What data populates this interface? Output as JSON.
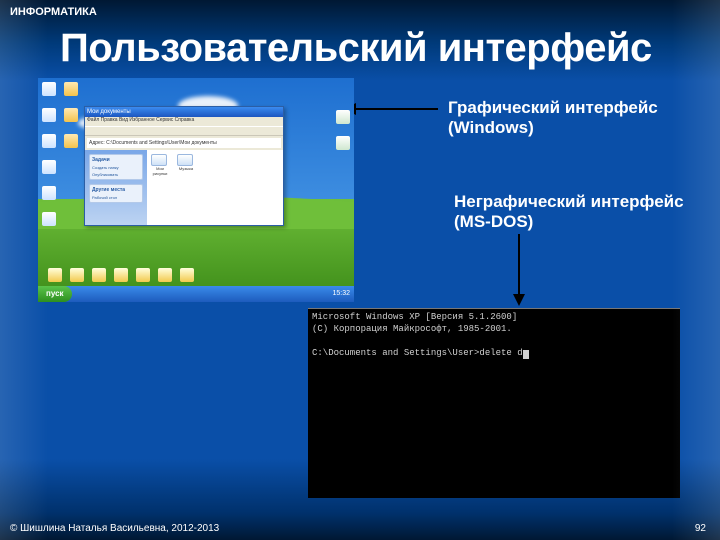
{
  "header": {
    "course": "ИНФОРМАТИКА"
  },
  "title": "Пользовательский интерфейс",
  "labels": {
    "gui_title": "Графический интерфейс",
    "gui_sub": "(Windows)",
    "cli_title": "Неграфический интерфейс",
    "cli_sub": "(MS-DOS)"
  },
  "winxp": {
    "start": "пуск",
    "tray_time": "15:32",
    "explorer": {
      "title": "Мои документы",
      "menu": "Файл  Правка  Вид  Избранное  Сервис  Справка",
      "address_label": "Адрес:",
      "address_value": "C:\\Documents and Settings\\User\\Мои документы",
      "side_tasks_h": "Задачи",
      "side_tasks_l1": "Создать папку",
      "side_tasks_l2": "Опубликовать",
      "side_places_h": "Другие места",
      "side_places_l1": "Рабочий стол",
      "file1": "Мои рисунки",
      "file2": "Музыка"
    }
  },
  "dos": {
    "line1": "Microsoft Windows XP [Версия 5.1.2600]",
    "line2": "(C) Корпорация Майкрософт, 1985-2001.",
    "prompt": "C:\\Documents and Settings\\User>delete d"
  },
  "footer": {
    "copyright": "© Шишлина Наталья Васильевна, 2012-2013",
    "page": "92"
  }
}
